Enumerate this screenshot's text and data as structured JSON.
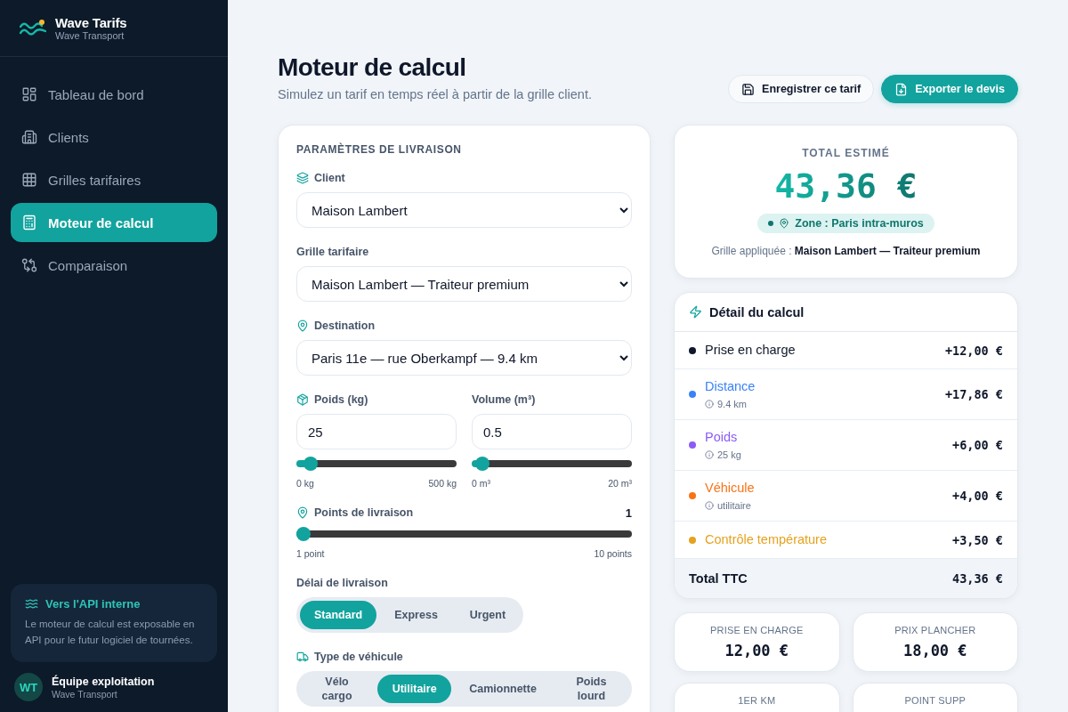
{
  "sidebar": {
    "brand": {
      "title": "Wave Tarifs",
      "subtitle": "Wave Transport"
    },
    "items": [
      {
        "label": "Tableau de bord",
        "selected": false
      },
      {
        "label": "Clients",
        "selected": false
      },
      {
        "label": "Grilles tarifaires",
        "selected": false
      },
      {
        "label": "Moteur de calcul",
        "selected": true
      },
      {
        "label": "Comparaison",
        "selected": false
      }
    ],
    "api_card": {
      "title": "Vers l'API interne",
      "text": "Le moteur de calcul est exposable en API pour le futur logiciel de tournées."
    },
    "user": {
      "initials": "WT",
      "name": "Équipe exploitation",
      "org": "Wave Transport"
    }
  },
  "header": {
    "title": "Moteur de calcul",
    "subtitle": "Simulez un tarif en temps réel à partir de la grille client.",
    "buttons": [
      {
        "label": "Enregistrer ce tarif",
        "kind": "secondary"
      },
      {
        "label": "Exporter le devis",
        "kind": "primary"
      }
    ]
  },
  "parameters": {
    "title": "PARAMÈTRES DE LIVRAISON",
    "client": {
      "label": "Client",
      "value": "Maison Lambert"
    },
    "grid": {
      "label": "Grille tarifaire",
      "value": "Maison Lambert — Traiteur premium"
    },
    "destination": {
      "label": "Destination",
      "value": "Paris 11e — rue Oberkampf — 9.4 km"
    },
    "weight": {
      "label": "Poids (kg)",
      "value": "25",
      "level": 0.05,
      "min_label": "0 kg",
      "max_label": "500 kg"
    },
    "volume": {
      "label": "Volume (m³)",
      "value": "0.5",
      "level": 0.025,
      "min_label": "0 m³",
      "max_label": "20 m³"
    },
    "points": {
      "label": "Points de livraison",
      "reading": "1",
      "level": 0,
      "min_label": "1 point",
      "max_label": "10 points"
    },
    "delay": {
      "label": "Délai de livraison",
      "options": [
        {
          "label": "Standard",
          "selected": true
        },
        {
          "label": "Express",
          "selected": false
        },
        {
          "label": "Urgent",
          "selected": false
        }
      ]
    },
    "vehicle": {
      "label": "Type de véhicule",
      "options": [
        {
          "label": "Vélo cargo",
          "selected": false
        },
        {
          "label": "Utilitaire",
          "selected": true
        },
        {
          "label": "Camionnette",
          "selected": false
        },
        {
          "label": "Poids lourd",
          "selected": false
        }
      ]
    }
  },
  "summary": {
    "title": "TOTAL ESTIMÉ",
    "amount": "43,36 €",
    "zone": "Zone : Paris intra-muros",
    "grid_text": "Grille appliquée : **Maison Lambert — Traiteur premium**"
  },
  "detail": {
    "title": "Détail du calcul",
    "rows": [
      {
        "label": "Prise en charge",
        "amount": "+12,00 €",
        "color": "#0f172a"
      },
      {
        "label": "Distance",
        "detail": "9.4 km",
        "amount": "+17,86 €",
        "color": "#3b82f6"
      },
      {
        "label": "Poids",
        "detail": "25 kg",
        "amount": "+6,00 €",
        "color": "#8b5cf6"
      },
      {
        "label": "Véhicule",
        "detail": "utilitaire",
        "amount": "+4,00 €",
        "color": "#f97316"
      },
      {
        "label": "Contrôle température",
        "amount": "+3,50 €",
        "color": "#e5a21f"
      }
    ],
    "total": {
      "label": "Total TTC",
      "amount": "43,36 €"
    }
  },
  "stats": [
    {
      "label": "PRISE EN CHARGE",
      "value": "12,00 €"
    },
    {
      "label": "PRIX PLANCHER",
      "value": "18,00 €"
    },
    {
      "label": "1ER KM"
    },
    {
      "label": "POINT SUPP"
    }
  ]
}
